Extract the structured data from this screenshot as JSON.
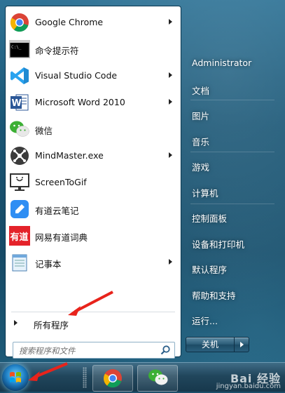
{
  "start_menu": {
    "programs": [
      {
        "label": "Google Chrome",
        "icon": "chrome-icon",
        "has_submenu": true
      },
      {
        "label": "命令提示符",
        "icon": "cmd-icon",
        "has_submenu": false
      },
      {
        "label": "Visual Studio Code",
        "icon": "vscode-icon",
        "has_submenu": true
      },
      {
        "label": "Microsoft Word 2010",
        "icon": "word-icon",
        "has_submenu": true
      },
      {
        "label": "微信",
        "icon": "wechat-icon",
        "has_submenu": false
      },
      {
        "label": "MindMaster.exe",
        "icon": "mindmaster-icon",
        "has_submenu": true
      },
      {
        "label": "ScreenToGif",
        "icon": "screentogif-icon",
        "has_submenu": false
      },
      {
        "label": "有道云笔记",
        "icon": "youdao-note-icon",
        "has_submenu": false
      },
      {
        "label": "网易有道词典",
        "icon": "youdao-dict-icon",
        "has_submenu": false
      },
      {
        "label": "记事本",
        "icon": "notepad-icon",
        "has_submenu": true
      }
    ],
    "all_programs_label": "所有程序",
    "search_placeholder": "搜索程序和文件",
    "right_items": [
      {
        "label": "Administrator"
      },
      {
        "label": "文档"
      },
      {
        "label": "图片"
      },
      {
        "label": "音乐"
      },
      {
        "label": "游戏"
      },
      {
        "label": "计算机"
      },
      {
        "label": "控制面板"
      },
      {
        "label": "设备和打印机"
      },
      {
        "label": "默认程序"
      },
      {
        "label": "帮助和支持"
      },
      {
        "label": "运行..."
      }
    ],
    "shutdown_label": "关机"
  },
  "taskbar": {
    "pinned": [
      {
        "icon": "chrome-icon"
      },
      {
        "icon": "wechat-icon"
      }
    ]
  },
  "watermark": {
    "brand": "Bai 经验",
    "url": "jingyan.baidu.com"
  },
  "colors": {
    "annotation_arrow": "#e8231b",
    "frame": "#1a5574"
  }
}
